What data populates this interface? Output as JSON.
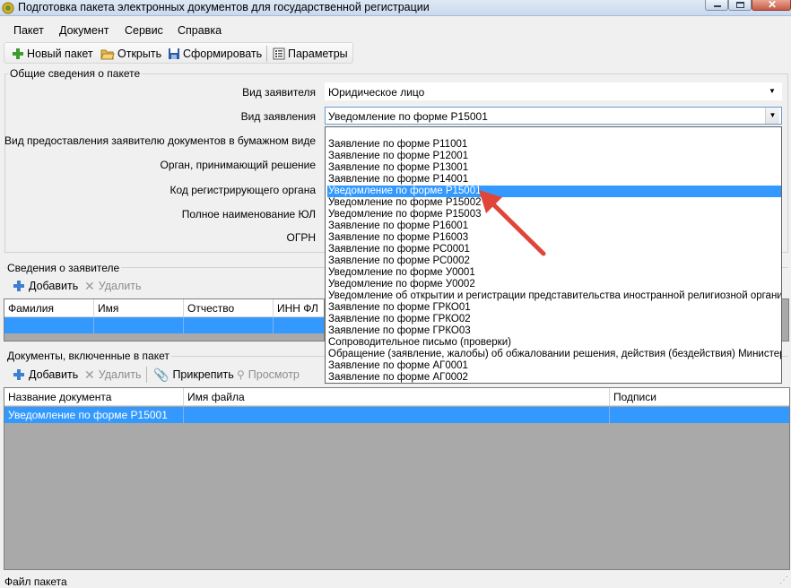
{
  "window": {
    "title": "Подготовка пакета электронных документов для государственной регистрации",
    "min_icon": "minimize-icon",
    "max_icon": "maximize-icon",
    "close_icon": "close-icon"
  },
  "menu": [
    "Пакет",
    "Документ",
    "Сервис",
    "Справка"
  ],
  "toolbar": {
    "new_label": "Новый пакет",
    "open_label": "Открыть",
    "build_label": "Сформировать",
    "params_label": "Параметры"
  },
  "general": {
    "title": "Общие сведения о пакете",
    "applicant_type_label": "Вид заявителя",
    "applicant_type_value": "Юридическое лицо",
    "statement_type_label": "Вид заявления",
    "statement_type_value": "Уведомление по форме Р15001",
    "paper_docs_label": "Вид предоставления заявителю документов в бумажном виде",
    "authority_label": "Орган, принимающий решение",
    "reg_code_label": "Код регистрирующего органа",
    "fullname_label": "Полное наименование ЮЛ",
    "ogrn_label": "ОГРН"
  },
  "dropdown": {
    "items": [
      "Заявление по форме Р11001",
      "Заявление по форме Р12001",
      "Заявление по форме Р13001",
      "Заявление по форме Р14001",
      "Уведомление по форме Р15001",
      "Уведомление по форме Р15002",
      "Уведомление по форме Р15003",
      "Заявление по форме Р16001",
      "Заявление по форме Р16003",
      "Заявление по форме РС0001",
      "Заявление по форме РС0002",
      "Уведомление по форме У0001",
      "Уведомление по форме У0002",
      "Уведомление об открытии и регистрации представительства иностранной религиозной организации",
      "Заявление по форме ГРКО01",
      "Заявление по форме ГРКО02",
      "Заявление по форме ГРКО03",
      "Сопроводительное письмо (проверки)",
      "Обращение (заявление, жалобы) об обжаловании решения, действия (бездействия) Министерства",
      "Заявление по форме АГ0001",
      "Заявление по форме АГ0002"
    ],
    "selected_index": 4
  },
  "applicants": {
    "title": "Сведения о заявителе",
    "add_label": "Добавить",
    "delete_label": "Удалить",
    "columns": [
      "Фамилия",
      "Имя",
      "Отчество",
      "ИНН ФЛ"
    ]
  },
  "documents": {
    "title": "Документы, включенные в пакет",
    "add_label": "Добавить",
    "delete_label": "Удалить",
    "attach_label": "Прикрепить",
    "view_label": "Просмотр",
    "columns": [
      "Название документа",
      "Имя файла",
      "Подписи"
    ],
    "rows": [
      {
        "name": "Уведомление по форме Р15001",
        "file": "",
        "signatures": ""
      }
    ]
  },
  "status": {
    "label": "Файл пакета"
  },
  "colors": {
    "selection": "#3399ff",
    "arrow": "#e0453a",
    "grid_bg": "#a9a9a9"
  }
}
